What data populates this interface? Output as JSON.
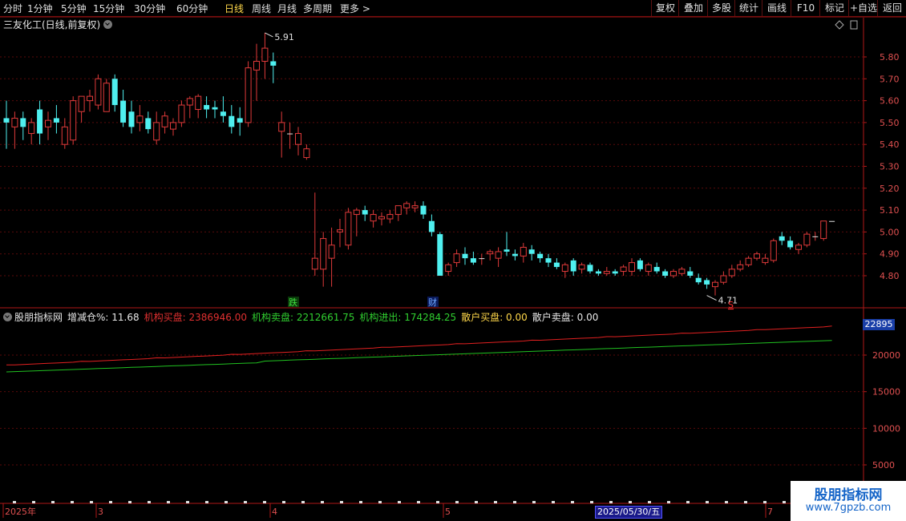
{
  "toolbar": {
    "periods": [
      "分时",
      "1分钟",
      "5分钟",
      "15分钟",
      "30分钟",
      "60分钟",
      "日线",
      "周线",
      "月线",
      "多周期",
      "更多 >"
    ],
    "active_period": "日线",
    "right_buttons": [
      "复权",
      "叠加",
      "多股",
      "统计",
      "画线",
      "F10",
      "标记",
      "+自选",
      "返回"
    ]
  },
  "chart_title": "三友化工(日线,前复权)",
  "price_axis": {
    "ticks": [
      "5.80",
      "5.70",
      "5.60",
      "5.50",
      "5.40",
      "5.30",
      "5.20",
      "5.10",
      "5.00",
      "4.90",
      "4.80"
    ]
  },
  "annotations": {
    "high_label": "5.91",
    "low_label": "4.71",
    "marker_die": "跌",
    "marker_cai": "财",
    "marker_s": "S"
  },
  "indicator": {
    "name": "股朋指标网",
    "fields": [
      {
        "label": "增减仓%: 11.68",
        "color": "#e8e8e8"
      },
      {
        "label": "机构买盘: 2386946.00",
        "color": "#e03030"
      },
      {
        "label": "机构卖盘: 2212661.75",
        "color": "#30d030"
      },
      {
        "label": "机构进出: 174284.25",
        "color": "#30d030"
      },
      {
        "label": "散户买盘: 0.00",
        "color": "#ffd84a"
      },
      {
        "label": "散户卖盘: 0.00",
        "color": "#e8e8e8"
      }
    ],
    "axis_ticks": [
      "20000",
      "15000",
      "10000",
      "5000"
    ],
    "flag_value": "22895"
  },
  "time_axis": {
    "labels": [
      "2025年",
      "3",
      "4",
      "5",
      "7"
    ],
    "cursor_date": "2025/05/30/五"
  },
  "watermark": {
    "title": "股朋指标网",
    "url": "www.7gpzb.com"
  },
  "candles": [
    [
      5.52,
      5.6,
      5.38,
      5.5
    ],
    [
      5.48,
      5.55,
      5.38,
      5.52
    ],
    [
      5.52,
      5.55,
      5.42,
      5.48
    ],
    [
      5.45,
      5.52,
      5.4,
      5.5
    ],
    [
      5.56,
      5.6,
      5.4,
      5.45
    ],
    [
      5.48,
      5.55,
      5.42,
      5.51
    ],
    [
      5.52,
      5.58,
      5.45,
      5.5
    ],
    [
      5.4,
      5.52,
      5.38,
      5.48
    ],
    [
      5.42,
      5.62,
      5.4,
      5.6
    ],
    [
      5.55,
      5.62,
      5.5,
      5.62
    ],
    [
      5.6,
      5.65,
      5.55,
      5.62
    ],
    [
      5.58,
      5.72,
      5.56,
      5.7
    ],
    [
      5.55,
      5.7,
      5.55,
      5.68
    ],
    [
      5.7,
      5.72,
      5.55,
      5.58
    ],
    [
      5.6,
      5.65,
      5.48,
      5.5
    ],
    [
      5.55,
      5.6,
      5.45,
      5.48
    ],
    [
      5.5,
      5.58,
      5.46,
      5.53
    ],
    [
      5.52,
      5.55,
      5.45,
      5.47
    ],
    [
      5.42,
      5.55,
      5.4,
      5.5
    ],
    [
      5.48,
      5.55,
      5.45,
      5.53
    ],
    [
      5.47,
      5.52,
      5.44,
      5.5
    ],
    [
      5.5,
      5.6,
      5.48,
      5.58
    ],
    [
      5.58,
      5.62,
      5.52,
      5.61
    ],
    [
      5.56,
      5.63,
      5.52,
      5.62
    ],
    [
      5.58,
      5.62,
      5.52,
      5.56
    ],
    [
      5.57,
      5.6,
      5.52,
      5.56
    ],
    [
      5.55,
      5.62,
      5.5,
      5.53
    ],
    [
      5.53,
      5.58,
      5.45,
      5.48
    ],
    [
      5.52,
      5.57,
      5.44,
      5.5
    ],
    [
      5.5,
      5.78,
      5.48,
      5.75
    ],
    [
      5.74,
      5.86,
      5.6,
      5.78
    ],
    [
      5.78,
      5.91,
      5.7,
      5.84
    ],
    [
      5.78,
      5.82,
      5.68,
      5.76
    ],
    [
      5.46,
      5.55,
      5.34,
      5.5
    ],
    [
      5.45,
      5.5,
      5.38,
      5.45
    ],
    [
      5.4,
      5.48,
      5.35,
      5.45
    ],
    [
      5.34,
      5.4,
      5.33,
      5.38
    ],
    [
      4.83,
      5.18,
      4.8,
      4.88
    ],
    [
      4.83,
      5.0,
      4.75,
      4.97
    ],
    [
      4.88,
      5.02,
      4.75,
      4.94
    ],
    [
      5.0,
      5.06,
      4.93,
      5.01
    ],
    [
      4.94,
      5.11,
      4.92,
      5.09
    ],
    [
      5.08,
      5.11,
      4.98,
      5.1
    ],
    [
      5.1,
      5.12,
      5.05,
      5.08
    ],
    [
      5.05,
      5.1,
      5.02,
      5.08
    ],
    [
      5.06,
      5.09,
      5.03,
      5.07
    ],
    [
      5.06,
      5.1,
      5.04,
      5.08
    ],
    [
      5.08,
      5.12,
      5.05,
      5.12
    ],
    [
      5.11,
      5.14,
      5.08,
      5.13
    ],
    [
      5.11,
      5.14,
      5.09,
      5.12
    ],
    [
      5.12,
      5.14,
      5.06,
      5.08
    ],
    [
      5.05,
      5.08,
      4.98,
      5.0
    ],
    [
      4.99,
      5.0,
      4.8,
      4.8
    ],
    [
      4.82,
      4.86,
      4.8,
      4.85
    ],
    [
      4.86,
      4.92,
      4.84,
      4.9
    ],
    [
      4.9,
      4.93,
      4.85,
      4.88
    ],
    [
      4.88,
      4.91,
      4.85,
      4.86
    ],
    [
      4.88,
      4.9,
      4.85,
      4.88
    ],
    [
      4.9,
      4.92,
      4.87,
      4.91
    ],
    [
      4.88,
      4.93,
      4.84,
      4.91
    ],
    [
      4.92,
      5.0,
      4.89,
      4.91
    ],
    [
      4.9,
      4.92,
      4.87,
      4.89
    ],
    [
      4.89,
      4.95,
      4.86,
      4.93
    ],
    [
      4.92,
      4.94,
      4.87,
      4.9
    ],
    [
      4.9,
      4.91,
      4.86,
      4.88
    ],
    [
      4.88,
      4.9,
      4.84,
      4.86
    ],
    [
      4.86,
      4.88,
      4.83,
      4.84
    ],
    [
      4.82,
      4.86,
      4.79,
      4.85
    ],
    [
      4.87,
      4.88,
      4.8,
      4.82
    ],
    [
      4.83,
      4.86,
      4.81,
      4.85
    ],
    [
      4.85,
      4.86,
      4.81,
      4.82
    ],
    [
      4.82,
      4.83,
      4.8,
      4.81
    ],
    [
      4.81,
      4.84,
      4.8,
      4.82
    ],
    [
      4.82,
      4.83,
      4.8,
      4.81
    ],
    [
      4.82,
      4.85,
      4.8,
      4.84
    ],
    [
      4.82,
      4.88,
      4.8,
      4.86
    ],
    [
      4.87,
      4.88,
      4.82,
      4.83
    ],
    [
      4.82,
      4.86,
      4.8,
      4.85
    ],
    [
      4.84,
      4.86,
      4.81,
      4.82
    ],
    [
      4.82,
      4.83,
      4.79,
      4.8
    ],
    [
      4.8,
      4.83,
      4.79,
      4.82
    ],
    [
      4.81,
      4.84,
      4.8,
      4.83
    ],
    [
      4.82,
      4.84,
      4.79,
      4.8
    ],
    [
      4.79,
      4.81,
      4.76,
      4.77
    ],
    [
      4.78,
      4.79,
      4.74,
      4.76
    ],
    [
      4.75,
      4.78,
      4.71,
      4.77
    ],
    [
      4.77,
      4.82,
      4.76,
      4.8
    ],
    [
      4.8,
      4.85,
      4.79,
      4.83
    ],
    [
      4.83,
      4.87,
      4.82,
      4.85
    ],
    [
      4.85,
      4.89,
      4.84,
      4.88
    ],
    [
      4.88,
      4.91,
      4.87,
      4.9
    ],
    [
      4.86,
      4.9,
      4.85,
      4.88
    ],
    [
      4.87,
      4.97,
      4.86,
      4.96
    ],
    [
      4.98,
      5.0,
      4.94,
      4.96
    ],
    [
      4.96,
      4.98,
      4.92,
      4.93
    ],
    [
      4.92,
      4.95,
      4.9,
      4.94
    ],
    [
      4.94,
      5.0,
      4.93,
      4.99
    ],
    [
      4.98,
      5.0,
      4.96,
      4.98
    ],
    [
      4.97,
      5.05,
      4.96,
      5.05
    ],
    [
      5.05,
      5.05,
      5.05,
      5.05
    ]
  ]
}
